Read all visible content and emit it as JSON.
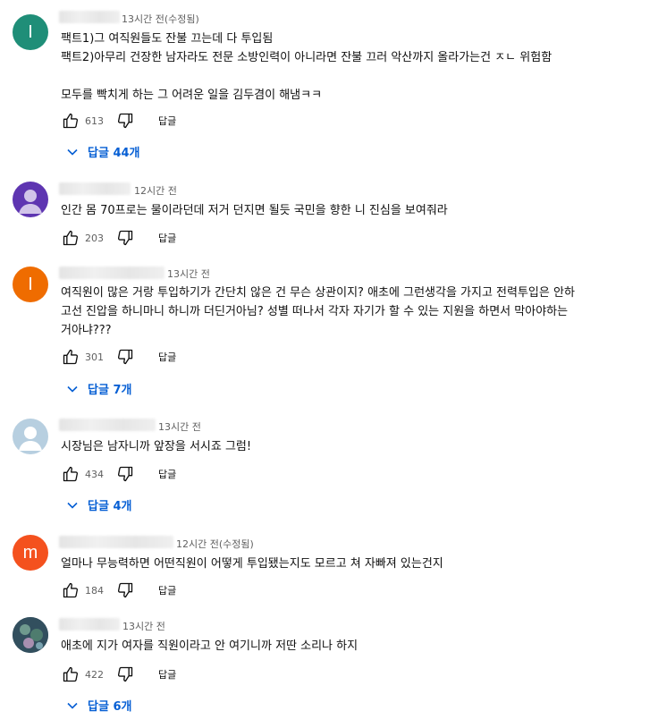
{
  "labels": {
    "reply": "답글"
  },
  "colors": {
    "link": "#065fd4",
    "muted": "#606060"
  },
  "comments": [
    {
      "avatar": {
        "kind": "letter",
        "letter": "I",
        "color": "#1f8e78"
      },
      "time": "13시간 전(수정됨)",
      "text": "팩트1)그 여직원들도 잔불 끄는데 다 투입됨\n팩트2)아무리 건장한 남자라도 전문 소방인력이 아니라면 잔불 끄러 악산까지 올라가는건 ㅈㄴ 위험함\n\n모두를 빡치게 하는 그 어려운 일을 김두겸이 해냄ㅋㅋ",
      "likes": "613",
      "replies": "답글 44개"
    },
    {
      "avatar": {
        "kind": "person",
        "color": "#5e35b1"
      },
      "time": "12시간 전",
      "text": "인간 몸 70프로는 물이라던데 저거 던지면 될듯 국민을 향한 니 진심을 보여줘라",
      "likes": "203"
    },
    {
      "avatar": {
        "kind": "letter",
        "letter": "I",
        "color": "#ef6c00"
      },
      "time": "13시간 전",
      "text": "여직원이 많은 거랑 투입하기가 간단치 않은 건 무슨 상관이지? 애초에 그런생각을 가지고 전력투입은 안하\n고선 진압을 하니마니 하니까 더딘거아님? 성별 떠나서 각자 자기가 할 수 있는 지원을 하면서 막아야하는\n거아냐???",
      "likes": "301",
      "replies": "답글 7개"
    },
    {
      "avatar": {
        "kind": "person",
        "color": "#b7cfe0"
      },
      "time": "13시간 전",
      "text": "시장님은 남자니까 앞장을 서시죠 그럼!",
      "likes": "434",
      "replies": "답글 4개"
    },
    {
      "avatar": {
        "kind": "letter",
        "letter": "m",
        "color": "#f4511e"
      },
      "time": "12시간 전(수정됨)",
      "text": "얼마나 무능력하면 어떤직원이 어떻게 투입됐는지도 모르고 쳐 자빠져 있는건지",
      "likes": "184"
    },
    {
      "avatar": {
        "kind": "photo",
        "color": "#2e4a5a"
      },
      "time": "13시간 전",
      "text": "애초에 지가 여자를 직원이라고 안 여기니까 저딴 소리나 하지",
      "likes": "422",
      "replies": "답글 6개"
    }
  ]
}
